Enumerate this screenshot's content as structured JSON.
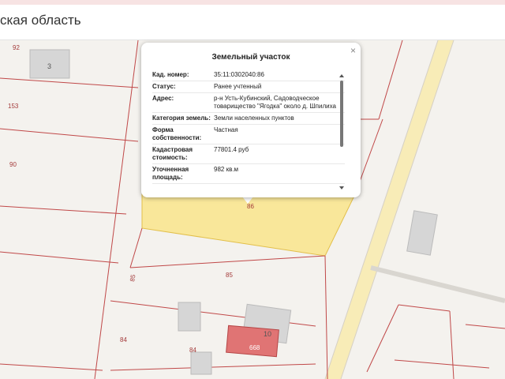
{
  "header": {
    "title": "ская область"
  },
  "map": {
    "parcel_labels": [
      "92",
      "153",
      "90",
      "85",
      "85",
      "84",
      "84",
      "86"
    ],
    "building_labels": [
      "3",
      "10",
      "668"
    ]
  },
  "popup": {
    "title": "Земельный участок",
    "close_glyph": "×",
    "rows": [
      {
        "key": "Кад. номер:",
        "value": "35:11:0302040:86"
      },
      {
        "key": "Статус:",
        "value": "Ранее учтенный"
      },
      {
        "key": "Адрес:",
        "value": "р-н Усть-Кубинский, Садоводческое товарищество \"Ягодка\" около д. Шпилиха"
      },
      {
        "key": "Категория земель:",
        "value": "Земли населенных пунктов"
      },
      {
        "key": "Форма собственности:",
        "value": "Частная"
      },
      {
        "key": "Кадастровая стоимость:",
        "value": "77801.4 руб"
      },
      {
        "key": "Уточненная площадь:",
        "value": "982 кв.м"
      }
    ]
  },
  "colors": {
    "parcel_line": "#c04848",
    "highlight": "#f9e79a",
    "road": "#f8ecb7",
    "building_selected": "#e07474"
  }
}
